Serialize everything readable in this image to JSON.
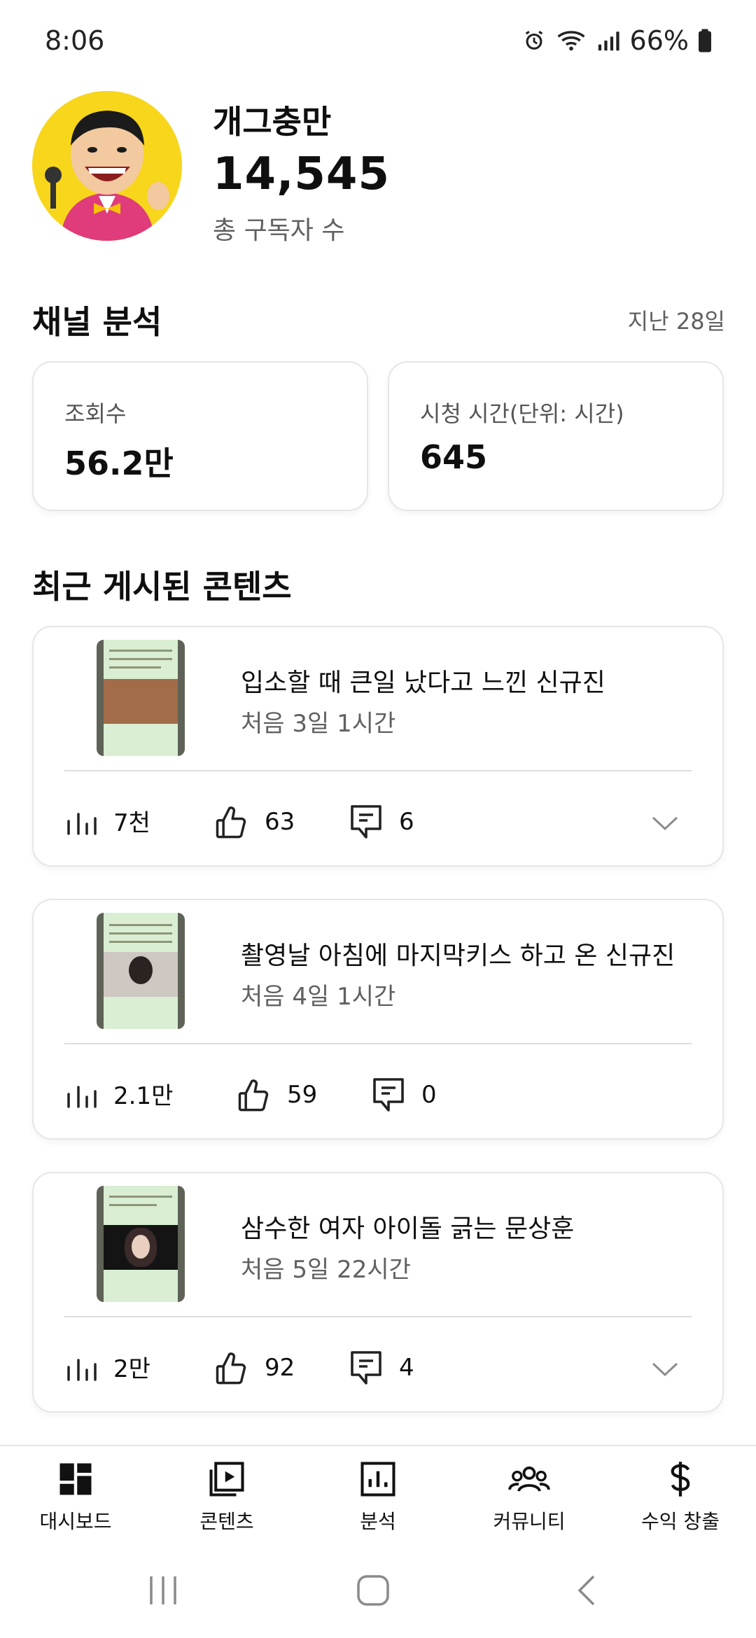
{
  "status_bar": {
    "time": "8:06",
    "battery": "66%"
  },
  "profile": {
    "channel_name": "개그충만",
    "subscribers": "14,545",
    "subscribers_label": "총 구독자 수"
  },
  "analytics": {
    "title": "채널 분석",
    "period": "지난 28일",
    "cards": [
      {
        "label": "조회수",
        "value": "56.2만"
      },
      {
        "label": "시청 시간(단위: 시간)",
        "value": "645"
      }
    ]
  },
  "recent": {
    "title": "최근 게시된 콘텐츠",
    "videos": [
      {
        "title": "입소할 때 큰일 났다고 느낀 신규진",
        "age": "처음 3일 1시간",
        "views": "7천",
        "likes": "63",
        "comments": "6"
      },
      {
        "title": "촬영날 아침에 마지막키스 하고 온 신규진",
        "age": "처음 4일 1시간",
        "views": "2.1만",
        "likes": "59",
        "comments": "0"
      },
      {
        "title": "삼수한 여자 아이돌 긁는 문상훈",
        "age": "처음 5일 22시간",
        "views": "2만",
        "likes": "92",
        "comments": "4"
      }
    ]
  },
  "nav": [
    {
      "label": "대시보드",
      "icon": "dashboard-icon"
    },
    {
      "label": "콘텐츠",
      "icon": "video-library-icon"
    },
    {
      "label": "분석",
      "icon": "analytics-icon"
    },
    {
      "label": "커뮤니티",
      "icon": "community-icon"
    },
    {
      "label": "수익 창출",
      "icon": "dollar-icon"
    }
  ],
  "colors": {
    "avatar_bg": "#f7d61c",
    "thumbnail_bg": "#d9eed3",
    "border": "#e6e6e6",
    "secondary_text": "#606060"
  }
}
